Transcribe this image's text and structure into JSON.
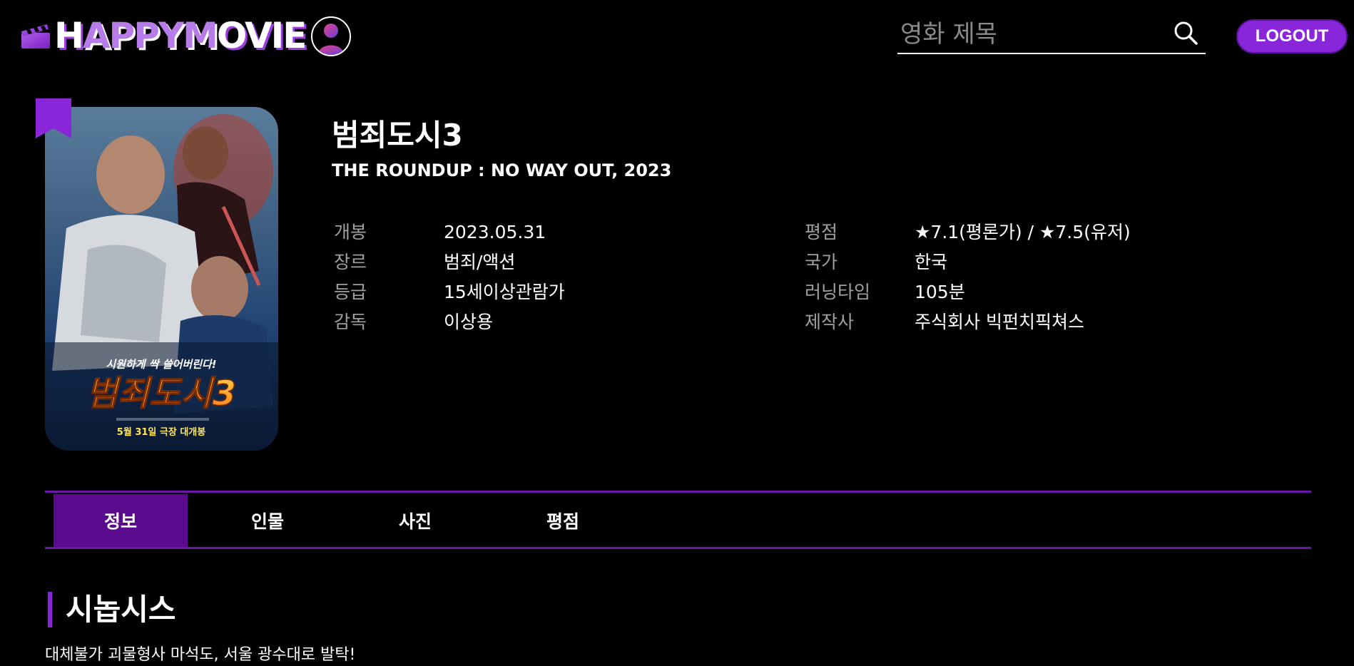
{
  "header": {
    "logo_white_1": "H",
    "logo_purple_1": "APPY",
    "logo_white_2": "M",
    "logo_purple_2": "OVIE",
    "search_placeholder": "영화 제목",
    "logout_label": "LOGOUT"
  },
  "poster": {
    "tagline": "시원하게 싹 쓸어버린다!",
    "title": "범죄도시3",
    "release_text": "5월 31일 극장 대개봉"
  },
  "movie": {
    "title_ko": "범죄도시3",
    "title_en": "THE ROUNDUP : NO WAY OUT, 2023"
  },
  "info_left": [
    {
      "label": "개봉",
      "value": "2023.05.31"
    },
    {
      "label": "장르",
      "value": "범죄/액션"
    },
    {
      "label": "등급",
      "value": "15세이상관람가"
    },
    {
      "label": "감독",
      "value": "이상용"
    }
  ],
  "info_right": [
    {
      "label": "평점",
      "value": "★7.1(평론가) / ★7.5(유저)"
    },
    {
      "label": "국가",
      "value": "한국"
    },
    {
      "label": "러닝타임",
      "value": "105분"
    },
    {
      "label": "제작사",
      "value": "주식회사 빅펀치픽쳐스"
    }
  ],
  "tabs": [
    {
      "label": "정보",
      "active": true
    },
    {
      "label": "인물",
      "active": false
    },
    {
      "label": "사진",
      "active": false
    },
    {
      "label": "평점",
      "active": false
    }
  ],
  "synopsis": {
    "heading": "시놉시스",
    "text": "대체불가 괴물형사 마석도, 서울 광수대로 발탁!"
  },
  "colors": {
    "accent": "#8a26d9",
    "tab_active": "#5a0a8c",
    "divider": "#6b16a8"
  },
  "icons": {
    "logo": "clapperboard-icon",
    "avatar": "user-avatar-icon",
    "search": "search-icon",
    "bookmark": "bookmark-icon"
  }
}
